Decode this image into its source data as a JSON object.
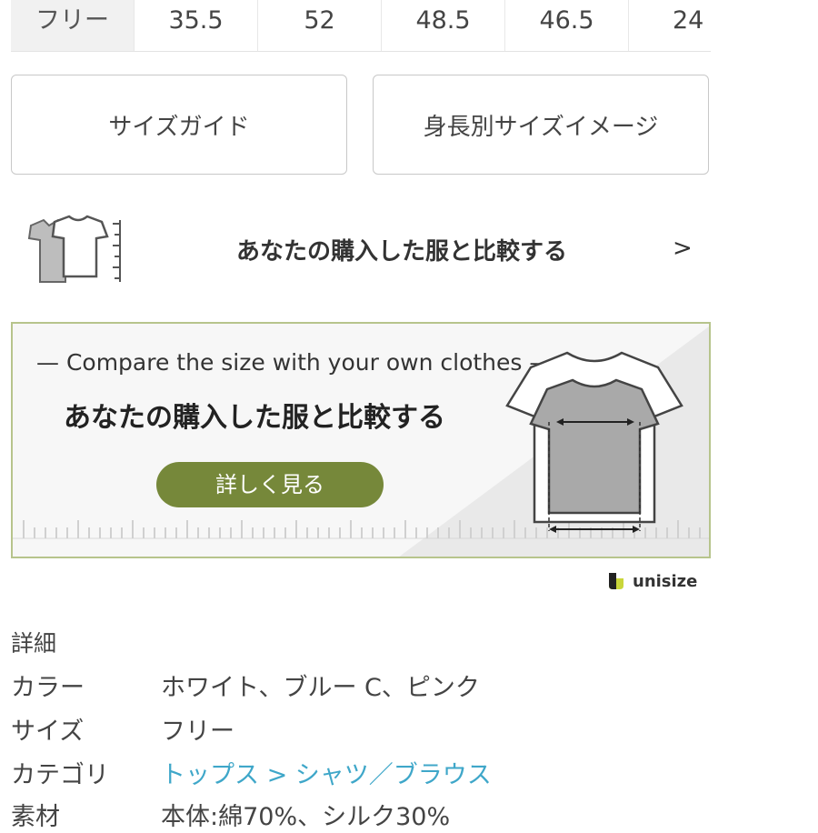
{
  "size_table": {
    "label": "フリー",
    "values": [
      "35.5",
      "52",
      "48.5",
      "46.5",
      "24"
    ]
  },
  "buttons": {
    "size_guide": "サイズガイド",
    "height_image": "身長別サイズイメージ"
  },
  "compare": {
    "text": "あなたの購入した服と比較する",
    "arrow": ">"
  },
  "banner": {
    "subtitle": "— Compare the size with your own clothes —",
    "title": "あなたの購入した服と比較する",
    "cta": "詳しく見る"
  },
  "logo": {
    "text": "unisize"
  },
  "details": {
    "heading": "詳細",
    "rows": [
      {
        "label": "カラー",
        "value": "ホワイト、ブルー C、ピンク"
      },
      {
        "label": "サイズ",
        "value": "フリー"
      },
      {
        "label": "カテゴリ",
        "value": "トップス > シャツ／ブラウス"
      },
      {
        "label": "素材",
        "value": "本体:綿70%、シルク30%"
      }
    ]
  },
  "colors": {
    "accent_green": "#76883a",
    "banner_border": "#b7c48c",
    "link_blue": "#3fa7c9"
  },
  "icons": [
    "tshirt-compare-icon",
    "chevron-right-icon",
    "tshirt-illustration",
    "unisize-logo-icon"
  ]
}
